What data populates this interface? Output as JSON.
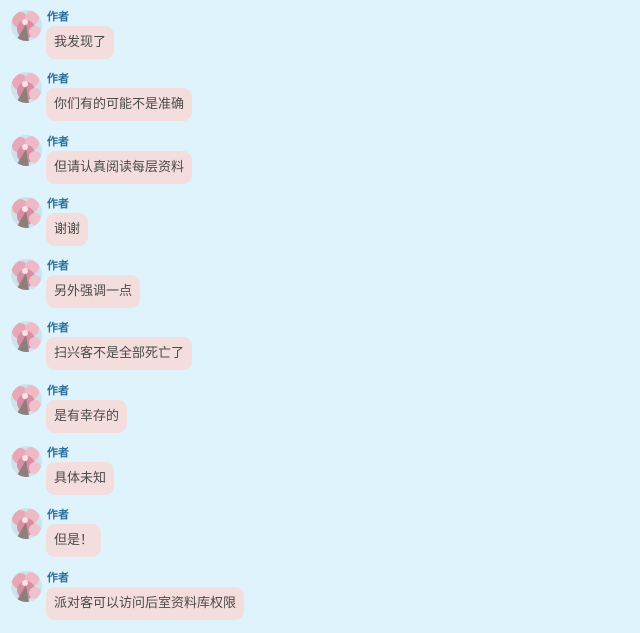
{
  "messages": [
    {
      "author": "作者",
      "text": "我发现了"
    },
    {
      "author": "作者",
      "text": "你们有的可能不是准确"
    },
    {
      "author": "作者",
      "text": "但请认真阅读每层资料"
    },
    {
      "author": "作者",
      "text": "谢谢"
    },
    {
      "author": "作者",
      "text": "另外强调一点"
    },
    {
      "author": "作者",
      "text": "扫兴客不是全部死亡了"
    },
    {
      "author": "作者",
      "text": "是有幸存的"
    },
    {
      "author": "作者",
      "text": "具体未知"
    },
    {
      "author": "作者",
      "text": "但是！"
    },
    {
      "author": "作者",
      "text": "派对客可以访问后室资料库权限"
    }
  ],
  "colors": {
    "background": "#dff3fd",
    "author": "#2a6f9e",
    "bubble": "#f4dedd",
    "text": "#4a4a4a"
  },
  "icons": {
    "avatar": "pink-flower-avatar-icon"
  }
}
